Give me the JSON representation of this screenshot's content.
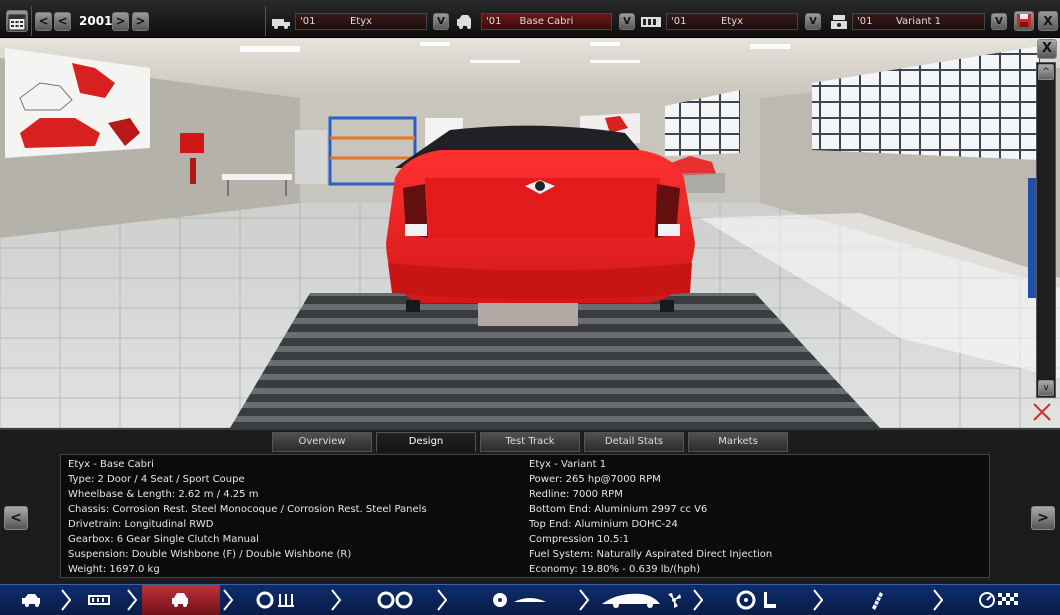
{
  "topbar": {
    "year": "2001",
    "prev_arrow": "<",
    "next_arrow": ">",
    "selectors": [
      {
        "icon": "car-model-icon",
        "num": "'01",
        "label": "Etyx",
        "v": "V",
        "active": false
      },
      {
        "icon": "trim-icon",
        "num": "'01",
        "label": "Base Cabri",
        "v": "V",
        "active": true
      },
      {
        "icon": "engine-family-icon",
        "num": "'01",
        "label": "Etyx",
        "v": "V",
        "active": false
      },
      {
        "icon": "engine-variant-icon",
        "num": "'01",
        "label": "Variant 1",
        "v": "V",
        "active": false
      }
    ],
    "close": "X"
  },
  "viewport": {
    "scroll_up": "^",
    "scroll_down": "v",
    "close": "X"
  },
  "tabs": [
    "Overview",
    "Design",
    "Test Track",
    "Detail Stats",
    "Markets"
  ],
  "active_tab": "Design",
  "info_left": [
    "Etyx - Base Cabri",
    "Type: 2 Door / 4 Seat / Sport Coupe",
    "Wheelbase & Length: 2.62 m / 4.25 m",
    "Chassis: Corrosion Rest. Steel Monocoque / Corrosion Rest. Steel Panels",
    "Drivetrain: Longitudinal RWD",
    "Gearbox: 6 Gear Single Clutch Manual",
    "Suspension: Double Wishbone (F) / Double Wishbone (R)",
    "Weight: 1697.0 kg"
  ],
  "info_right": [
    "Etyx - Variant 1",
    "Power: 265 hp@7000 RPM",
    "Redline: 7000 RPM",
    "Bottom End: Aluminium 2997 cc V6",
    "Top End: Aluminium DOHC-24",
    "Compression 10.5:1",
    "Fuel System: Naturally Aspirated Direct Injection",
    "Economy: 19.80% - 0.639 lb/(hph)"
  ],
  "nav": {
    "prev": "<",
    "next": ">"
  },
  "steps": [
    {
      "name": "car-step",
      "active": false
    },
    {
      "name": "chassis-step",
      "active": false
    },
    {
      "name": "body-step",
      "active": true
    },
    {
      "name": "suspension-step",
      "active": false
    },
    {
      "name": "wheels-step",
      "active": false
    },
    {
      "name": "aero-step",
      "active": false
    },
    {
      "name": "interior-step",
      "active": false
    },
    {
      "name": "engine-step",
      "active": false
    },
    {
      "name": "test-step",
      "active": false
    }
  ],
  "colors": {
    "car": "#ee2222",
    "active_step": "#c0303a",
    "step_bar": "#0d2d6b"
  }
}
